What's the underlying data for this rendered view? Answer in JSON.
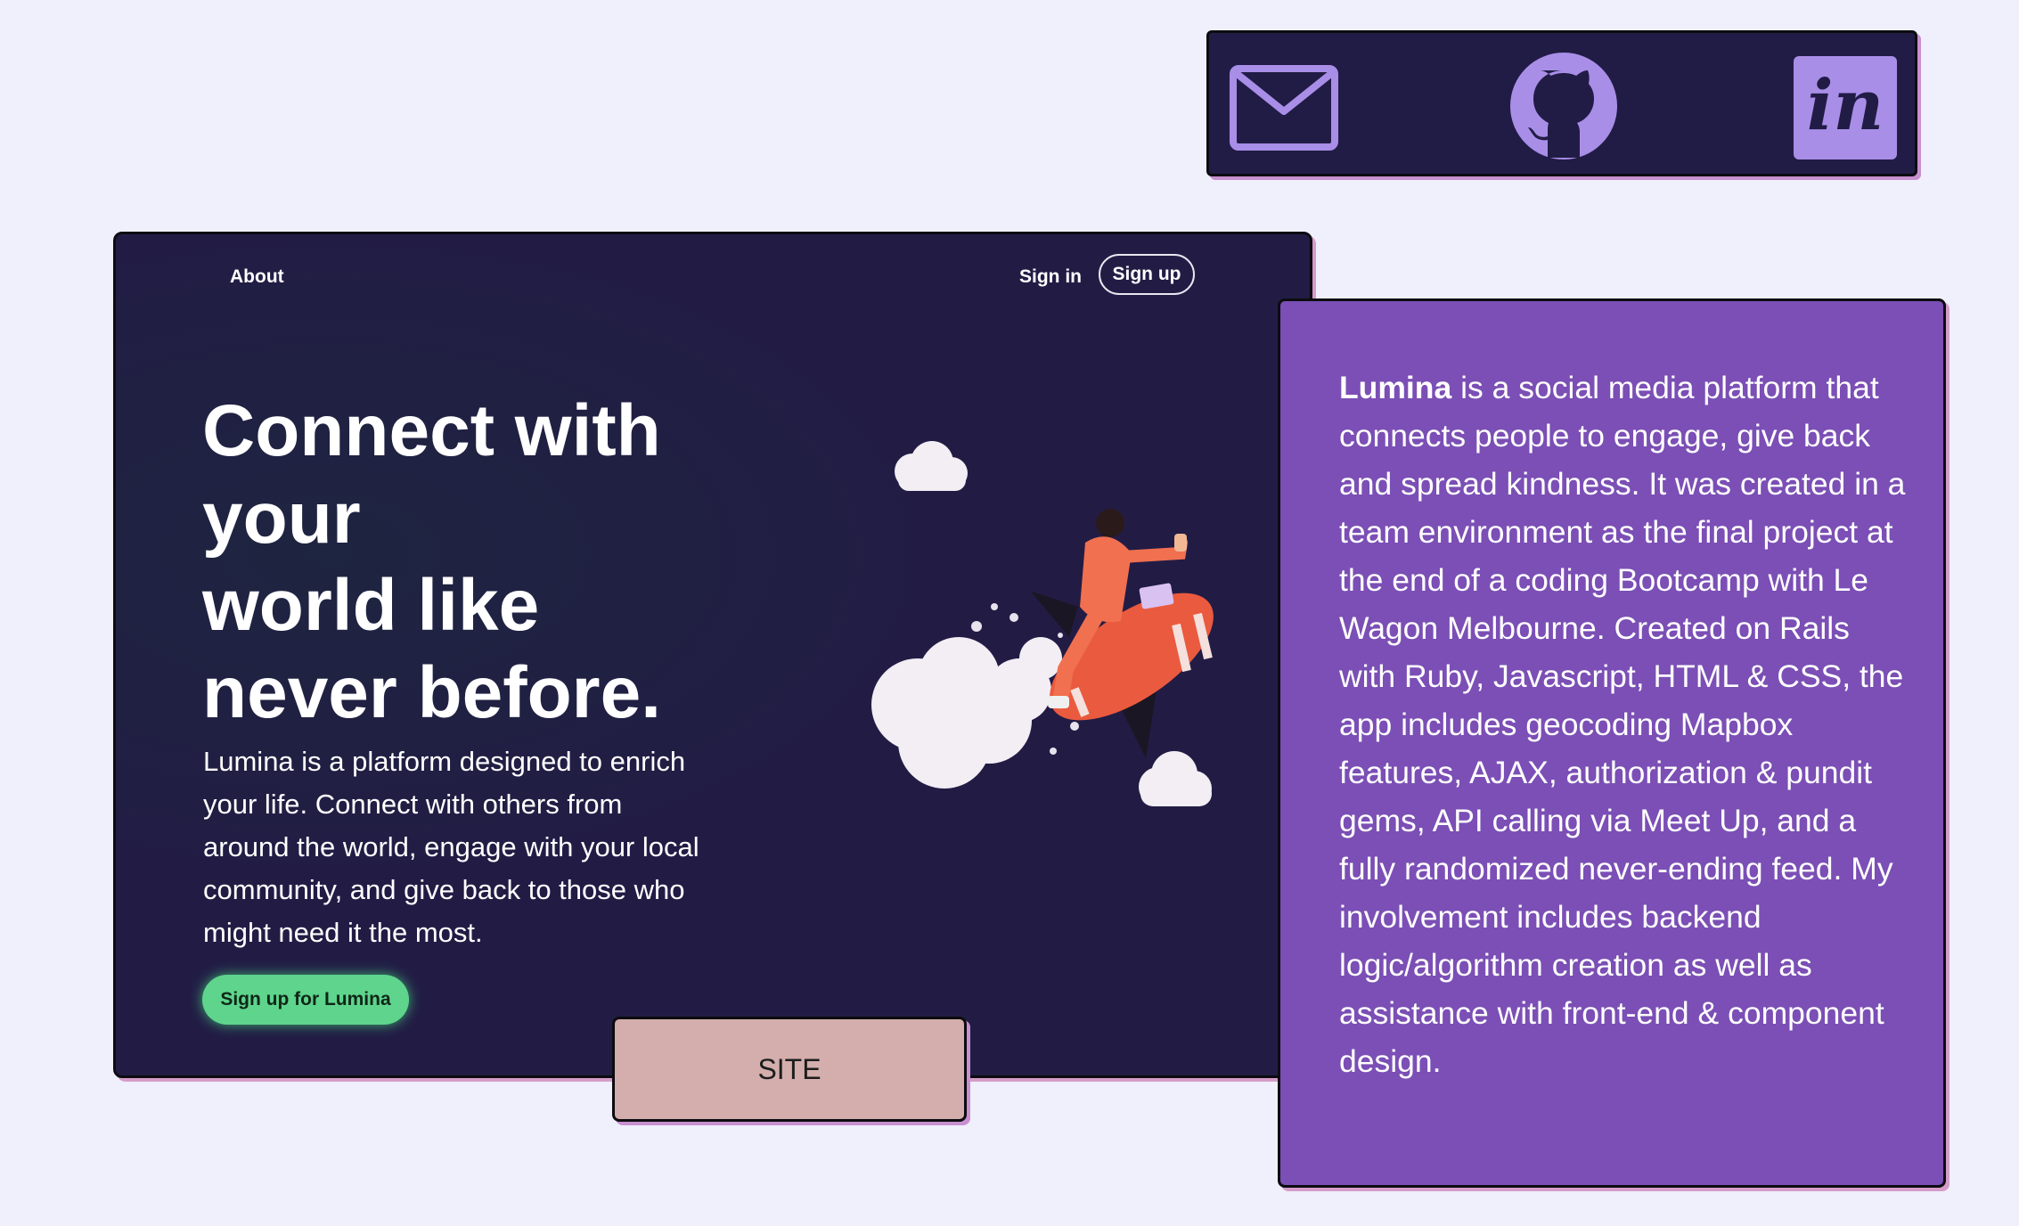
{
  "social": {
    "icons": [
      "mail-icon",
      "github-icon",
      "invision-icon"
    ],
    "colors": {
      "bar": "#211c45",
      "icon": "#a98ee8"
    }
  },
  "preview": {
    "nav": {
      "about": "About",
      "sign_in": "Sign in",
      "sign_up": "Sign up"
    },
    "hero": {
      "title_lines": [
        "Connect with",
        "your",
        "world like",
        "never before."
      ],
      "description": "Lumina is a platform designed to enrich your life. Connect with others from around the world, engage with your local community, and give back to those who might need it the most.",
      "cta": "Sign up for Lumina"
    },
    "colors": {
      "background": "#221c45",
      "cta": "#5ed48c"
    }
  },
  "site_button": {
    "label": "SITE"
  },
  "description": {
    "brand": "Lumina",
    "text": " is a social media platform that connects people to engage, give back and spread kindness. It was created in a team environment as the final project at the end of a coding Bootcamp with Le Wagon Melbourne. Created on Rails with Ruby, Javascript, HTML & CSS, the app includes geocoding Mapbox features, AJAX, authorization & pundit gems, API calling via Meet Up, and a fully randomized never-ending feed. My involvement includes backend logic/algorithm creation as well as assistance with front-end & component design.",
    "colors": {
      "card": "#7b4fb5"
    }
  }
}
